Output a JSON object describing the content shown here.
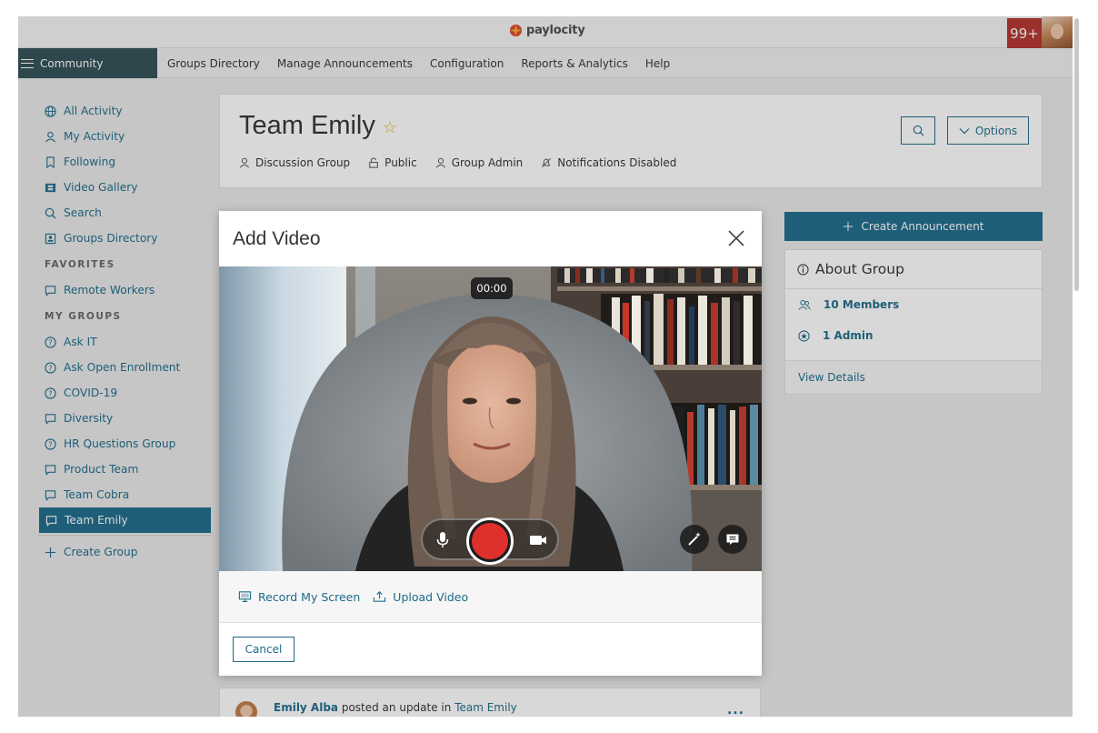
{
  "header": {
    "brand": "paylocity",
    "notification_count": "99+"
  },
  "nav": {
    "community": "Community",
    "links": [
      "Groups Directory",
      "Manage Announcements",
      "Configuration",
      "Reports & Analytics",
      "Help"
    ]
  },
  "sidebar": {
    "top_items": [
      {
        "label": "All Activity",
        "icon": "globe-icon"
      },
      {
        "label": "My Activity",
        "icon": "user-icon"
      },
      {
        "label": "Following",
        "icon": "bookmark-icon"
      },
      {
        "label": "Video Gallery",
        "icon": "film-icon"
      },
      {
        "label": "Search",
        "icon": "search-icon"
      },
      {
        "label": "Groups Directory",
        "icon": "directory-icon"
      }
    ],
    "favorites_heading": "FAVORITES",
    "favorites": [
      {
        "label": "Remote Workers",
        "icon": "chat-icon"
      }
    ],
    "my_groups_heading": "MY GROUPS",
    "groups": [
      {
        "label": "Ask IT",
        "icon": "question-icon"
      },
      {
        "label": "Ask Open Enrollment",
        "icon": "question-icon"
      },
      {
        "label": "COVID-19",
        "icon": "question-icon"
      },
      {
        "label": "Diversity",
        "icon": "chat-icon"
      },
      {
        "label": "HR Questions Group",
        "icon": "question-icon"
      },
      {
        "label": "Product Team",
        "icon": "chat-icon"
      },
      {
        "label": "Team Cobra",
        "icon": "chat-icon"
      },
      {
        "label": "Team Emily",
        "icon": "chat-icon"
      }
    ],
    "create_group": "Create Group"
  },
  "group": {
    "title": "Team Emily",
    "meta": [
      "Discussion Group",
      "Public",
      "Group Admin",
      "Notifications Disabled"
    ],
    "options_label": "Options"
  },
  "right_panel": {
    "create_announcement": "Create Announcement",
    "about_title": "About Group",
    "members": "10 Members",
    "admins": "1 Admin",
    "view_details": "View Details"
  },
  "feed": {
    "author": "Emily Alba",
    "action": " posted an update in ",
    "group": "Team Emily",
    "more": "..."
  },
  "modal": {
    "title": "Add Video",
    "timer": "00:00",
    "record_screen": "Record My Screen",
    "upload_video": "Upload Video",
    "cancel": "Cancel"
  },
  "colors": {
    "accent": "#1d6b8a",
    "nav_dark": "#2f4f55",
    "record_red": "#e0302c",
    "badge_red": "#b5322f",
    "star": "#e3b21b"
  }
}
